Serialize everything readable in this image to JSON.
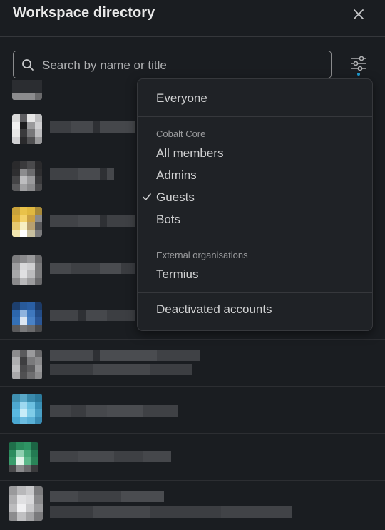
{
  "header": {
    "title": "Workspace directory",
    "close_icon": "close-icon"
  },
  "search": {
    "placeholder": "Search by name or title",
    "value": "",
    "icon": "search-icon"
  },
  "filter": {
    "icon": "sliders-icon",
    "active_indicator_color": "#1d9bd1"
  },
  "menu": {
    "everyone": "Everyone",
    "groups": [
      {
        "heading": "Cobalt Core",
        "items": [
          {
            "label": "All members",
            "checked": false
          },
          {
            "label": "Admins",
            "checked": false
          },
          {
            "label": "Guests",
            "checked": true
          },
          {
            "label": "Bots",
            "checked": false
          }
        ]
      },
      {
        "heading": "External organisations",
        "items": [
          {
            "label": "Termius",
            "checked": false
          }
        ]
      }
    ],
    "deactivated": "Deactivated accounts"
  },
  "colors": {
    "background": "#1a1d21",
    "menu_background": "#1f2226",
    "text": "#d1d2d3",
    "muted": "#9b9c9e",
    "accent": "#1d9bd1"
  }
}
